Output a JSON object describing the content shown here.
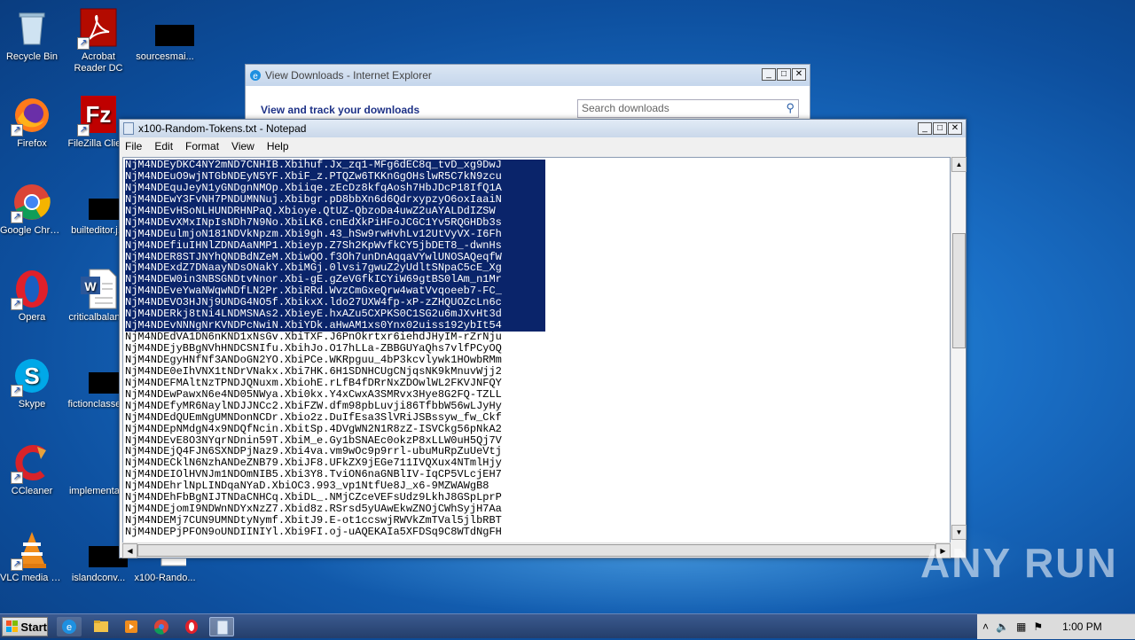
{
  "desktop": {
    "icons": [
      {
        "label": "Recycle Bin"
      },
      {
        "label": "Acrobat Reader DC"
      },
      {
        "label": "sourcesmai..."
      },
      {
        "label": "Firefox"
      },
      {
        "label": "FileZilla Client"
      },
      {
        "label": "Google Chrome"
      },
      {
        "label": "builteditor.j..."
      },
      {
        "label": "Opera"
      },
      {
        "label": "criticalbalan..."
      },
      {
        "label": "Skype"
      },
      {
        "label": "fictionclasse..."
      },
      {
        "label": "CCleaner"
      },
      {
        "label": "implementa..."
      },
      {
        "label": "VLC media player"
      },
      {
        "label": "islandconv..."
      },
      {
        "label": "x100-Rando..."
      }
    ]
  },
  "ie_window": {
    "title": "View Downloads - Internet Explorer",
    "heading": "View and track your downloads",
    "search_placeholder": "Search downloads"
  },
  "notepad": {
    "title": "x100-Random-Tokens.txt - Notepad",
    "menu": [
      "File",
      "Edit",
      "Format",
      "View",
      "Help"
    ],
    "selected_line_count": 15,
    "lines": [
      "NjM4NDEyDKC4NY2mND7CNHIB.Xbihuf.Jx_zq1-MFg6dEC8q_tvD_xg9DwJ",
      "NjM4NDEuO9wjNTGbNDEyN5YF.XbiF_z.PTQZw6TKKnGgOHslwR5C7kN9zcu",
      "NjM4NDEquJeyN1yGNDgnNMOp.Xbiiqe.zEcDz8kfqAosh7HbJDcP18IfQ1A",
      "NjM4NDEwY3FvNH7PNDUMNNuj.Xbibgr.pD8bbXn6d6QdrxypzyO6oxIaaiN",
      "NjM4NDEvHSoNLHUNDRHNPaQ.Xbioye.QtUZ-QbzoDa4uwZ2uAYALDdIZSW",
      "NjM4NDEvXMxINpIsNDh7N9No.XbiLK6.cnEdXkPiHFoJCGC1Yv5RQGHDb3s",
      "NjM4NDEulmjoN181NDVkNpzm.Xbi9gh.43_hSw9rwHvhLv12UtVyVX-I6Fh",
      "NjM4NDEfiuIHNlZDNDAaNMP1.Xbieyp.Z7Sh2KpWvfkCY5jbDET8_-dwnHs",
      "NjM4NDER8STJNYhQNDBdNZeM.XbiwQO.f3Oh7unDnAqqaVYwlUNOSAQeqfW",
      "NjM4NDExdZ7DNaayNDsONakY.XbiMGj.0lvsi7gwuZ2yUdltSNpaC5cE_Xg",
      "NjM4NDEW0in3NBSGNDtvNnor.Xbi-gE.gZeVGfkICYiW69gtBS0lAm_n1Mr",
      "NjM4NDEveYwaNWqwNDfLN2Pr.XbiRRd.WvzCmGxeQrw4watVvqoeeb7-FC_",
      "NjM4NDEVO3HJNj9UNDG4NO5f.XbikxX.ldo27UXW4fp-xP-zZHQUOZcLn6c",
      "NjM4NDERkj8tNi4LNDMSNAs2.XbieyE.hxAZu5CXPKS0C1SG2u6mJXvHt3d",
      "NjM4NDEvNNNgNrKVNDPcNwiN.XbiYDk.aHwAM1xs0Ynx02uiss192ybIt54",
      "NjM4NDEdVA1DN6nKND1xNsGv.XbiTXF.J6PnOkrtxr6iehdJHyIM-rZrNju",
      "NjM4NDEjyBBgNVhHNDCSNIfu.XbihJo.O17hLLa-ZBBGUYaQhs7vlfPCyOQ",
      "NjM4NDEgyHNfNf3ANDoGN2YO.XbiPCe.WKRpguu_4bP3kcvlywk1HOwbRMm",
      "NjM4NDE0eIhVNX1tNDrVNakx.Xbi7HK.6H1SDNHCUgCNjqsNK9kMnuvWjj2",
      "NjM4NDEFMAltNzTPNDJQNuxm.XbiohE.rLfB4fDRrNxZDOwlWL2FKVJNFQY",
      "NjM4NDEwPawxN6e4ND05NWya.Xbi0kx.Y4xCwxA3SMRvx3Hye8G2FQ-TZLL",
      "NjM4NDEfyMR6NaylNDJJNCc2.XbiFZW.dfm98pbLuvji86TfbbW56wLJyHy",
      "NjM4NDEdQUEmNgUMNDonNCDr.Xbio2z.DuIfEsa3SlVRiJSBssyw_fw_Ckf",
      "NjM4NDEpNMdgN4x9NDQfNcin.XbitSp.4DVgWN2N1R8zZ-ISVCkg56pNkA2",
      "NjM4NDEvE8O3NYqrNDnin59T.XbiM_e.Gy1bSNAEc0okzP8xLLW0uH5Qj7V",
      "NjM4NDEjQ4FJN6SXNDPjNaz9.Xbi4va.vm9wOc9p9rrl-ubuMuRpZuUeVtj",
      "NjM4NDECklN6NzhANDeZNB79.XbiJF8.UFkZX9jEGe711IVQXux4NTmlHjy",
      "NjM4NDEIOlHVNJm1NDOmNIB5.Xbi3Y8.TviON6naGNBlIV-IqCP5VLcjEH7",
      "NjM4NDEhrlNpLINDqaNYaD.XbiOC3.993_vp1NtfUe8J_x6-9MZWAWgB8",
      "NjM4NDEhFbBgNIJTNDaCNHCq.XbiDL_.NMjCZceVEFsUdz9LkhJ8GSpLprP",
      "NjM4NDEjomI9NDWnNDYxNzZ7.Xbid8z.RSrsd5yUAwEkwZNOjCWhSyjH7Aa",
      "NjM4NDEMj7CUN9UMNDtyNymf.XbitJ9.E-ot1ccswjRWVkZmTVal5jlbRBT",
      "NjM4NDEPjPFON9oUNDIINIYl.Xbi9FI.oj-uAQEKAIa5XFDSq9C8WTdNgFH"
    ]
  },
  "taskbar": {
    "start_label": "Start",
    "clock": "1:00 PM"
  },
  "watermark": "ANY RUN"
}
